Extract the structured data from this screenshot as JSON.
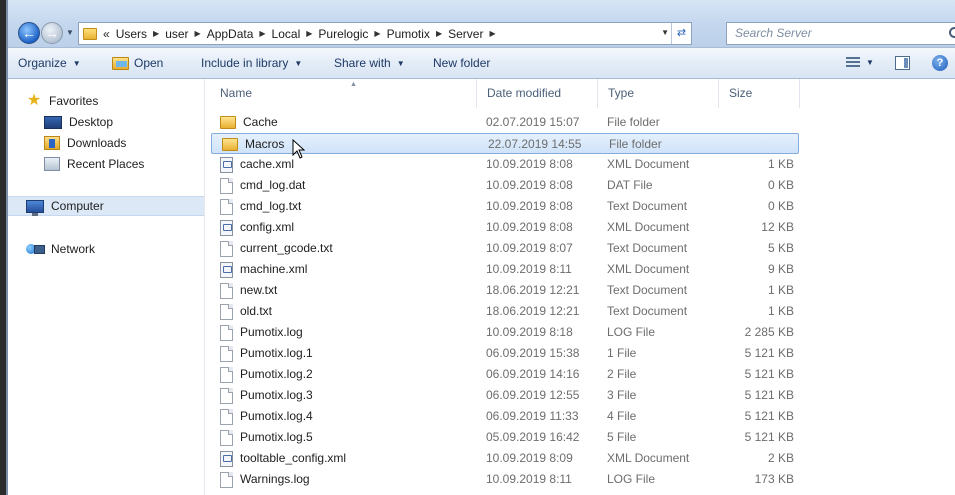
{
  "address_bar": {
    "overflow": "«",
    "crumbs": [
      "Users",
      "user",
      "AppData",
      "Local",
      "Purelogic",
      "Pumotix",
      "Server"
    ],
    "search_placeholder": "Search Server"
  },
  "toolbar": {
    "organize": "Organize",
    "open": "Open",
    "include_in_library": "Include in library",
    "share_with": "Share with",
    "new_folder": "New folder"
  },
  "navigation": {
    "favorites": "Favorites",
    "desktop": "Desktop",
    "downloads": "Downloads",
    "recent_places": "Recent Places",
    "computer": "Computer",
    "network": "Network"
  },
  "columns": {
    "name": "Name",
    "date_modified": "Date modified",
    "type": "Type",
    "size": "Size"
  },
  "files": [
    {
      "name": "Cache",
      "date": "02.07.2019 15:07",
      "type": "File folder",
      "size": "",
      "icon": "folder-icon"
    },
    {
      "name": "Macros",
      "date": "22.07.2019 14:55",
      "type": "File folder",
      "size": "",
      "icon": "folder-icon",
      "selected": true
    },
    {
      "name": "cache.xml",
      "date": "10.09.2019 8:08",
      "type": "XML Document",
      "size": "1 KB",
      "icon": "xml-file-icon"
    },
    {
      "name": "cmd_log.dat",
      "date": "10.09.2019 8:08",
      "type": "DAT File",
      "size": "0 KB",
      "icon": "file-icon"
    },
    {
      "name": "cmd_log.txt",
      "date": "10.09.2019 8:08",
      "type": "Text Document",
      "size": "0 KB",
      "icon": "file-icon"
    },
    {
      "name": "config.xml",
      "date": "10.09.2019 8:08",
      "type": "XML Document",
      "size": "12 KB",
      "icon": "xml-file-icon"
    },
    {
      "name": "current_gcode.txt",
      "date": "10.09.2019 8:07",
      "type": "Text Document",
      "size": "5 KB",
      "icon": "file-icon"
    },
    {
      "name": "machine.xml",
      "date": "10.09.2019 8:11",
      "type": "XML Document",
      "size": "9 KB",
      "icon": "xml-file-icon"
    },
    {
      "name": "new.txt",
      "date": "18.06.2019 12:21",
      "type": "Text Document",
      "size": "1 KB",
      "icon": "file-icon"
    },
    {
      "name": "old.txt",
      "date": "18.06.2019 12:21",
      "type": "Text Document",
      "size": "1 KB",
      "icon": "file-icon"
    },
    {
      "name": "Pumotix.log",
      "date": "10.09.2019 8:18",
      "type": "LOG File",
      "size": "2 285 KB",
      "icon": "file-icon"
    },
    {
      "name": "Pumotix.log.1",
      "date": "06.09.2019 15:38",
      "type": "1 File",
      "size": "5 121 KB",
      "icon": "file-icon"
    },
    {
      "name": "Pumotix.log.2",
      "date": "06.09.2019 14:16",
      "type": "2 File",
      "size": "5 121 KB",
      "icon": "file-icon"
    },
    {
      "name": "Pumotix.log.3",
      "date": "06.09.2019 12:55",
      "type": "3 File",
      "size": "5 121 KB",
      "icon": "file-icon"
    },
    {
      "name": "Pumotix.log.4",
      "date": "06.09.2019 11:33",
      "type": "4 File",
      "size": "5 121 KB",
      "icon": "file-icon"
    },
    {
      "name": "Pumotix.log.5",
      "date": "05.09.2019 16:42",
      "type": "5 File",
      "size": "5 121 KB",
      "icon": "file-icon"
    },
    {
      "name": "tooltable_config.xml",
      "date": "10.09.2019 8:09",
      "type": "XML Document",
      "size": "2 KB",
      "icon": "xml-file-icon"
    },
    {
      "name": "Warnings.log",
      "date": "10.09.2019 8:11",
      "type": "LOG File",
      "size": "173 KB",
      "icon": "file-icon"
    }
  ]
}
